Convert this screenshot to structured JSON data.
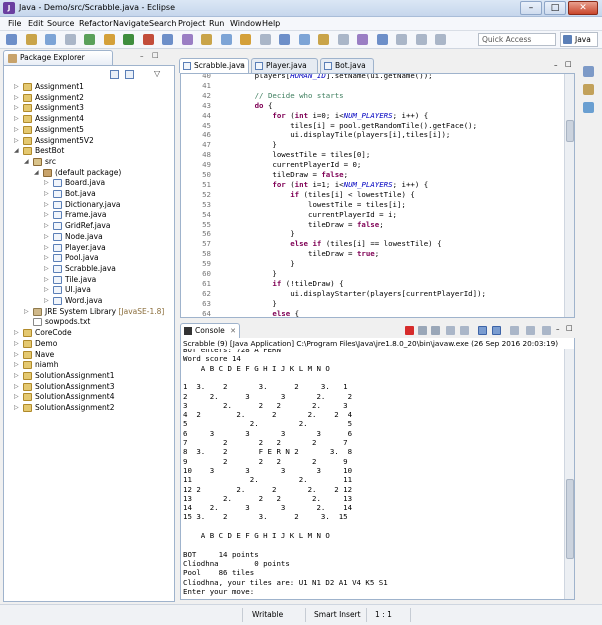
{
  "window": {
    "title": "Java - Demo/src/Scrabble.java - Eclipse",
    "min": "–",
    "max": "□",
    "close": "✕"
  },
  "menu": [
    "File",
    "Edit",
    "Source",
    "Refactor",
    "Navigate",
    "Search",
    "Project",
    "Run",
    "Window",
    "Help"
  ],
  "toolbar": {
    "quick_access_placeholder": "Quick Access",
    "perspective": "Java"
  },
  "package_explorer": {
    "title": "Package Explorer",
    "tree": [
      {
        "label": "Assignment1",
        "indent": 0,
        "icon": "project-icon",
        "arrow": "▷"
      },
      {
        "label": "Assignment2",
        "indent": 0,
        "icon": "project-icon",
        "arrow": "▷"
      },
      {
        "label": "Assignment3",
        "indent": 0,
        "icon": "project-icon",
        "arrow": "▷"
      },
      {
        "label": "Assignment4",
        "indent": 0,
        "icon": "project-icon",
        "arrow": "▷"
      },
      {
        "label": "Assignment5",
        "indent": 0,
        "icon": "project-icon",
        "arrow": "▷"
      },
      {
        "label": "Assignment5V2",
        "indent": 0,
        "icon": "project-icon",
        "arrow": "▷"
      },
      {
        "label": "BestBot",
        "indent": 0,
        "icon": "project-icon",
        "arrow": "◢"
      },
      {
        "label": "src",
        "indent": 1,
        "icon": "source-folder-icon",
        "arrow": "◢"
      },
      {
        "label": "(default package)",
        "indent": 2,
        "icon": "package-icon",
        "arrow": "◢"
      },
      {
        "label": "Board.java",
        "indent": 3,
        "icon": "java-file-icon",
        "arrow": "▷"
      },
      {
        "label": "Bot.java",
        "indent": 3,
        "icon": "java-file-icon",
        "arrow": "▷"
      },
      {
        "label": "Dictionary.java",
        "indent": 3,
        "icon": "java-file-icon",
        "arrow": "▷"
      },
      {
        "label": "Frame.java",
        "indent": 3,
        "icon": "java-file-icon",
        "arrow": "▷"
      },
      {
        "label": "GridRef.java",
        "indent": 3,
        "icon": "java-file-icon",
        "arrow": "▷"
      },
      {
        "label": "Node.java",
        "indent": 3,
        "icon": "java-file-icon",
        "arrow": "▷"
      },
      {
        "label": "Player.java",
        "indent": 3,
        "icon": "java-file-icon",
        "arrow": "▷"
      },
      {
        "label": "Pool.java",
        "indent": 3,
        "icon": "java-file-icon",
        "arrow": "▷"
      },
      {
        "label": "Scrabble.java",
        "indent": 3,
        "icon": "java-file-icon",
        "arrow": "▷"
      },
      {
        "label": "Tile.java",
        "indent": 3,
        "icon": "java-file-icon",
        "arrow": "▷"
      },
      {
        "label": "UI.java",
        "indent": 3,
        "icon": "java-file-icon",
        "arrow": "▷"
      },
      {
        "label": "Word.java",
        "indent": 3,
        "icon": "java-file-icon",
        "arrow": "▷"
      },
      {
        "label": "JRE System Library",
        "suffix": " [JavaSE-1.8]",
        "indent": 1,
        "icon": "library-icon",
        "arrow": "▷"
      },
      {
        "label": "sowpods.txt",
        "indent": 1,
        "icon": "text-file-icon",
        "arrow": ""
      },
      {
        "label": "CoreCode",
        "indent": 0,
        "icon": "project-icon",
        "arrow": "▷"
      },
      {
        "label": "Demo",
        "indent": 0,
        "icon": "project-icon",
        "arrow": "▷"
      },
      {
        "label": "Nave",
        "indent": 0,
        "icon": "project-icon",
        "arrow": "▷"
      },
      {
        "label": "niamh",
        "indent": 0,
        "icon": "project-icon",
        "arrow": "▷"
      },
      {
        "label": "SolutionAssignment1",
        "indent": 0,
        "icon": "project-icon",
        "arrow": "▷"
      },
      {
        "label": "SolutionAssignment3",
        "indent": 0,
        "icon": "project-icon",
        "arrow": "▷"
      },
      {
        "label": "SolutionAssignment4",
        "indent": 0,
        "icon": "project-icon",
        "arrow": "▷"
      },
      {
        "label": "SolutionAssignment2",
        "indent": 0,
        "icon": "project-icon",
        "arrow": "▷"
      }
    ]
  },
  "editor": {
    "tabs": [
      {
        "label": "Scrabble.java",
        "active": true
      },
      {
        "label": "Player.java",
        "active": false
      },
      {
        "label": "Bot.java",
        "active": false
      }
    ],
    "lines": [
      {
        "n": "40",
        "code": "        players[HUMAN_ID].setName(ui.getName());"
      },
      {
        "n": "41",
        "code": ""
      },
      {
        "n": "42",
        "code": "        // Decide who starts"
      },
      {
        "n": "43",
        "code": "        do {"
      },
      {
        "n": "44",
        "code": "            for (int i=0; i<NUM_PLAYERS; i++) {"
      },
      {
        "n": "45",
        "code": "                tiles[i] = pool.getRandomTile().getFace();"
      },
      {
        "n": "46",
        "code": "                ui.displayTile(players[i],tiles[i]);"
      },
      {
        "n": "47",
        "code": "            }"
      },
      {
        "n": "48",
        "code": "            lowestTile = tiles[0];"
      },
      {
        "n": "49",
        "code": "            currentPlayerId = 0;"
      },
      {
        "n": "50",
        "code": "            tileDraw = false;"
      },
      {
        "n": "51",
        "code": "            for (int i=1; i<NUM_PLAYERS; i++) {"
      },
      {
        "n": "52",
        "code": "                if (tiles[i] < lowestTile) {"
      },
      {
        "n": "53",
        "code": "                    lowestTile = tiles[i];"
      },
      {
        "n": "54",
        "code": "                    currentPlayerId = i;"
      },
      {
        "n": "55",
        "code": "                    tileDraw = false;"
      },
      {
        "n": "56",
        "code": "                }"
      },
      {
        "n": "57",
        "code": "                else if (tiles[i] == lowestTile) {"
      },
      {
        "n": "58",
        "code": "                    tileDraw = true;"
      },
      {
        "n": "59",
        "code": "                }"
      },
      {
        "n": "60",
        "code": "            }"
      },
      {
        "n": "61",
        "code": "            if (!tileDraw) {"
      },
      {
        "n": "62",
        "code": "                ui.displayStarter(players[currentPlayerId]);"
      },
      {
        "n": "63",
        "code": "            }"
      },
      {
        "n": "64",
        "code": "            else {"
      },
      {
        "n": "65",
        "code": "                ui.displayStarterDraw();"
      }
    ]
  },
  "console": {
    "title": "Console",
    "header": "Scrabble (9) [Java Application] C:\\Program Files\\Java\\jre1.8.0_20\\bin\\javaw.exe (26 Sep 2016 20:03:19)",
    "lines": [
      "BOT enters: 728 A FERN",
      "Word score 14",
      "    A B C D E F G H I J K L M N O",
      "",
      "1  3.    2       3.      2     3.   1",
      "2     2.      3       3       2.     2",
      "3        2.      2   2       2.     3",
      "4  2        2.      2       2.    2  4",
      "5              2.         2.         5",
      "6     3       3       3       3      6",
      "7        2       2   2       2      7",
      "8  3.    2       F E R N 2       3.  8",
      "9        2       2   2       2      9",
      "10    3       3       3       3     10",
      "11             2.         2.        11",
      "12 2        2.      2       2.    2 12",
      "13       2.      2   2       2.     13",
      "14    2.      3       3       2.    14",
      "15 3.    2       3.      2     3.  15",
      "",
      "    A B C D E F G H I J K L M N O",
      "",
      "BOT     14 points",
      "Clíodhna        0 points",
      "Pool    86 tiles",
      "Clíodhna, your tiles are: U1 N1 D2 A1 V4 K5 S1",
      "Enter your move:"
    ]
  },
  "status": {
    "writable": "Writable",
    "insert_mode": "Smart Insert",
    "position": "1 : 1"
  }
}
